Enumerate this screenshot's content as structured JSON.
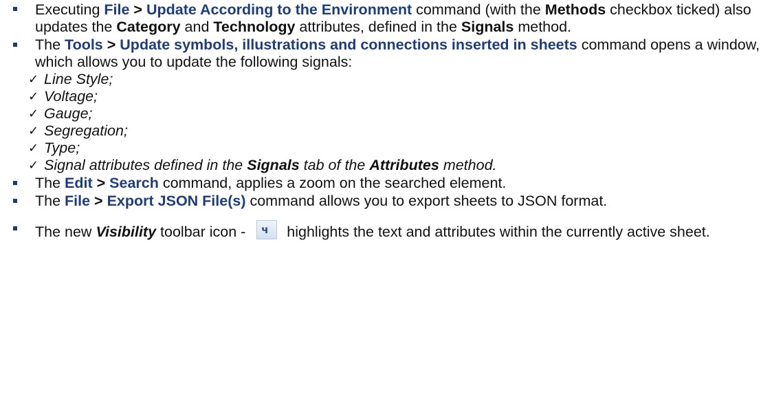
{
  "bullets": [
    {
      "pre": "Executing ",
      "cmd_a": "File",
      "sep": " > ",
      "cmd_b": "Update According to the Environment",
      "mid1": " command (with the ",
      "bold1": "Methods",
      "mid2": " checkbox ticked) also updates the ",
      "bold2": "Category",
      "mid3": " and ",
      "bold3": "Technology",
      "mid4": " attributes, defined in the ",
      "bold4": "Signals",
      "post": " method."
    },
    {
      "pre": "The ",
      "cmd_a": "Tools",
      "sep": " > ",
      "cmd_b": "Update symbols, illustrations and connections inserted in sheets",
      "post": " command opens a window, which allows you to update the following signals:",
      "checks": [
        "Line Style;",
        "Voltage;",
        "Gauge;",
        "Segregation;",
        "Type;"
      ],
      "last_check": {
        "pre": "Signal attributes defined in the ",
        "bold1": "Signals",
        "mid": " tab of the ",
        "bold2": "Attributes",
        "post": " method."
      }
    },
    {
      "pre": "The ",
      "cmd_a": "Edit",
      "sep": " > ",
      "cmd_b": "Search",
      "post": " command, applies a zoom on the searched element."
    },
    {
      "pre": "The ",
      "cmd_a": "File",
      "sep": " > ",
      "cmd_b": "Export JSON File(s)",
      "post": " command allows you to export sheets to JSON format."
    },
    {
      "pre": "The new ",
      "bold_ital": "Visibility",
      "mid": " toolbar icon - ",
      "icon": "visibility-toolbar-icon",
      "post": " highlights the text and attributes within the currently active sheet."
    }
  ],
  "colors": {
    "command": "#1f3d7a",
    "bullet_marker": "#1f3d6b",
    "text": "#111111"
  }
}
